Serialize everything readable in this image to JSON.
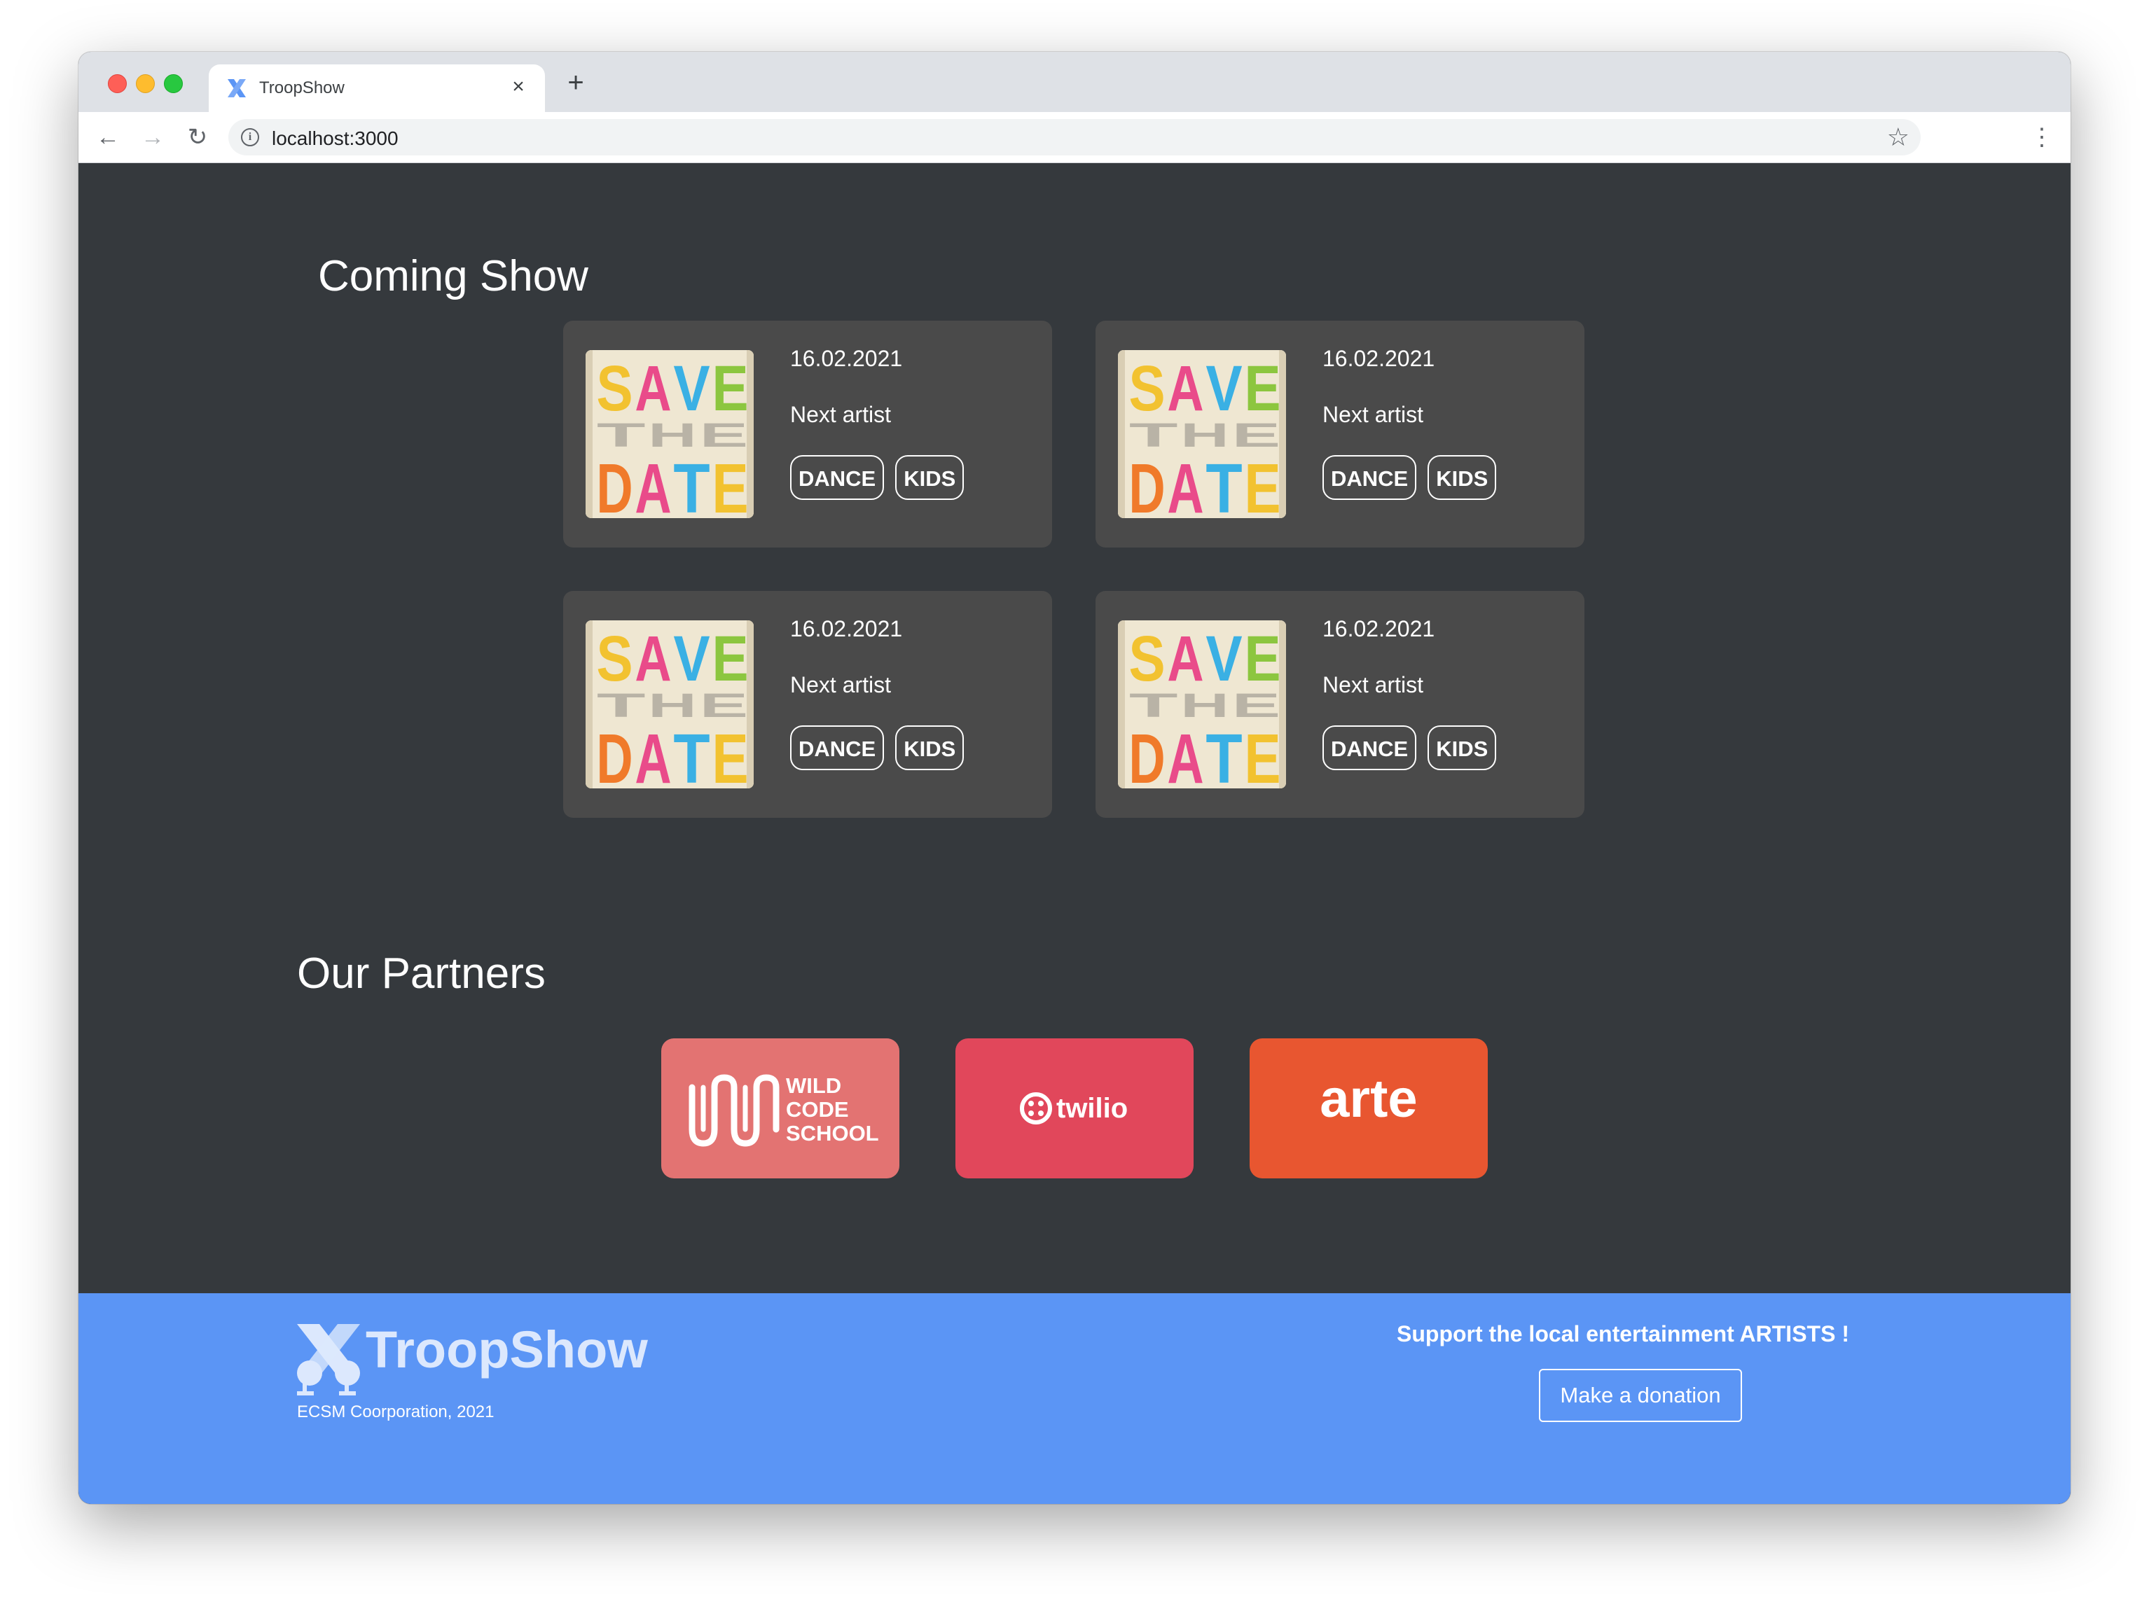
{
  "browser": {
    "tab_title": "TroopShow",
    "url": "localhost:3000",
    "close_glyph": "×",
    "new_tab_glyph": "+",
    "back_glyph": "←",
    "forward_glyph": "→",
    "reload_glyph": "↻",
    "info_glyph": "i",
    "star_glyph": "☆",
    "menu_glyph": "⋮"
  },
  "coming_show": {
    "title": "Coming Show",
    "poster_text": [
      "SAVE",
      "THE",
      "DATE"
    ],
    "cards": [
      {
        "date": "16.02.2021",
        "artist": "Next artist",
        "tags": [
          "DANCE",
          "KIDS"
        ]
      },
      {
        "date": "16.02.2021",
        "artist": "Next artist",
        "tags": [
          "DANCE",
          "KIDS"
        ]
      },
      {
        "date": "16.02.2021",
        "artist": "Next artist",
        "tags": [
          "DANCE",
          "KIDS"
        ]
      },
      {
        "date": "16.02.2021",
        "artist": "Next artist",
        "tags": [
          "DANCE",
          "KIDS"
        ]
      }
    ]
  },
  "partners": {
    "title": "Our Partners",
    "items": [
      {
        "name": "WILD CODE SCHOOL",
        "lines": [
          "WILD",
          "CODE",
          "SCHOOL"
        ],
        "color": "#e37372"
      },
      {
        "name": "twilio",
        "color": "#e1475b"
      },
      {
        "name": "arte",
        "color": "#e85630"
      }
    ]
  },
  "footer": {
    "brand": "TroopShow",
    "copyright": "ECSM Coorporation, 2021",
    "tagline": "Support the local entertainment ARTISTS !",
    "donate_label": "Make a donation",
    "background": "#5b95f5"
  }
}
